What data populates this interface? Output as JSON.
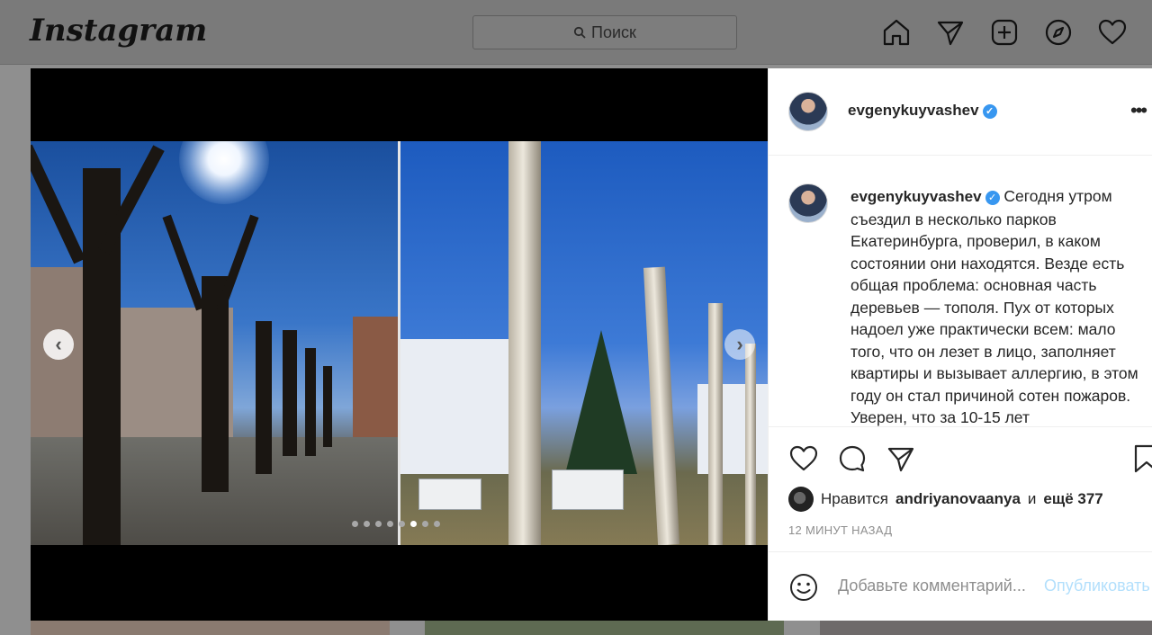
{
  "nav": {
    "logo": "Instagram",
    "search_placeholder": "Поиск",
    "icons": [
      "home-icon",
      "direct-icon",
      "new-post-icon",
      "explore-icon",
      "activity-icon"
    ]
  },
  "post": {
    "author": {
      "username": "evgenykuyvashev",
      "verified": true
    },
    "carousel": {
      "slide_count": 8,
      "active_slide": 5
    },
    "caption": "Сегодня утром съездил в несколько парков Екатеринбурга, проверил, в каком состоянии они находятся. Везде есть общая проблема: основная часть деревьев — тополя. Пух от которых надоел уже практически всем: мало того, что он лезет в лицо, заполняет квартиры и вызывает аллергию, в этом году он стал причиной сотен пожаров. Уверен, что за 10-15 лет",
    "likes": {
      "prefix": "Нравится",
      "liker": "andriyanovaanya",
      "joiner": "и",
      "others": "ещё 377"
    },
    "timestamp": "12 МИНУТ НАЗАД",
    "comment_placeholder": "Добавьте комментарий...",
    "publish_label": "Опубликовать"
  },
  "colors": {
    "verified": "#3897f0",
    "publish_disabled": "#b2dffc",
    "muted_text": "#8e8e8e"
  }
}
